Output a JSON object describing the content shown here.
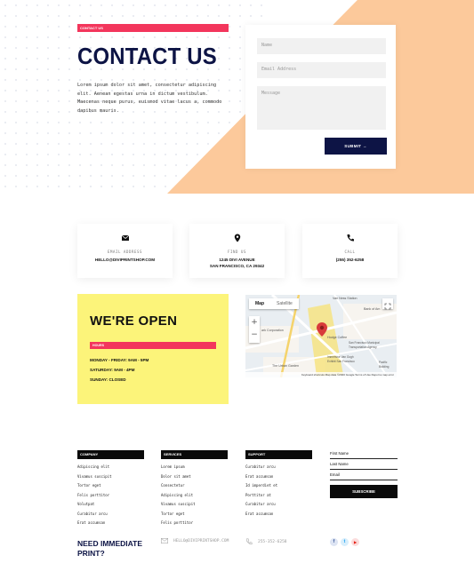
{
  "hero": {
    "tag": "CONTACT US",
    "title": "CONTACT US",
    "body": "Lorem ipsum dolor sit amet, consectetur adipiscing elit. Aenean egestas urna in dictum vestibulum. Maecenas neque purus, euismod vitae lacus a, commodo dapibus mauris."
  },
  "form": {
    "name_placeholder": "Name",
    "email_placeholder": "Email Address",
    "message_placeholder": "Message",
    "submit_label": "SUBMIT →"
  },
  "info_cards": [
    {
      "icon": "envelope-icon",
      "label": "EMAIL ADDRESS",
      "value": "HELLO@DIVIPRINTSHOP.COM"
    },
    {
      "icon": "location-pin-icon",
      "label": "FIND US",
      "value": "1245 DIVI AVENUE\nSAN FRANCISCO, CA 29342"
    },
    {
      "icon": "phone-icon",
      "label": "CALL",
      "value": "(255) 352-6258"
    }
  ],
  "open": {
    "title": "WE'RE OPEN",
    "tag": "HOURS",
    "hours": [
      "MONDAY - FRIDAY: 9AM - 5PM",
      "SATURDAY: 9AM - 4PM",
      "SUNDAY: CLOSED"
    ]
  },
  "map": {
    "tab_map": "Map",
    "tab_satellite": "Satellite",
    "zoom_in": "+",
    "zoom_out": "−",
    "footer": "Keyboard shortcuts   Map data ©2020 Google   Terms of Use   Report a map error",
    "labels": [
      "Van Ness Station",
      "Bank of Am",
      "Hodge Coffee",
      "San Francisco Municipal Transportation Agency",
      "Immersive Van Gogh Exhibit San Francisco",
      "The Urban Garden",
      "ark Corporation",
      "Pacific Building"
    ]
  },
  "footer": {
    "columns": [
      {
        "head": "COMPANY",
        "items": [
          "Adipiscing elit",
          "Vivamus suscipit",
          "Tortor eget",
          "Felis porttitor",
          "Volutpat",
          "Curabitur arcu",
          "Erat accumsan"
        ]
      },
      {
        "head": "SERVICES",
        "items": [
          "Lorem ipsum",
          "Dolor sit amet",
          "Consectetur",
          "Adipiscing elit",
          "Vivamus suscipit",
          "Tortor eget",
          "Felis porttitor"
        ]
      },
      {
        "head": "SUPPORT",
        "items": [
          "Curabitur arcu",
          "Erat accumsan",
          "Id imperdiet et",
          "Porttitor at",
          "Curabitur arcu",
          "Erat accumsan"
        ]
      }
    ],
    "subscribe": {
      "first_name": "First Name",
      "last_name": "Last Name",
      "email": "Email",
      "button": "SUBSCRIBE"
    },
    "need_print": "NEED IMMEDIATE PRINT?",
    "email": "HELLO@DIVIPRINTSHOP.COM",
    "phone": "255-352-6258",
    "socials": [
      {
        "name": "facebook-icon",
        "glyph": "f",
        "color": "#3b5998"
      },
      {
        "name": "twitter-icon",
        "glyph": "t",
        "color": "#1da1f2"
      },
      {
        "name": "youtube-icon",
        "glyph": "▶",
        "color": "#e62117"
      }
    ]
  },
  "colors": {
    "accent": "#f3365c",
    "navy": "#0d1445",
    "peach": "#fcc99b",
    "yellow": "#fcf47a"
  }
}
